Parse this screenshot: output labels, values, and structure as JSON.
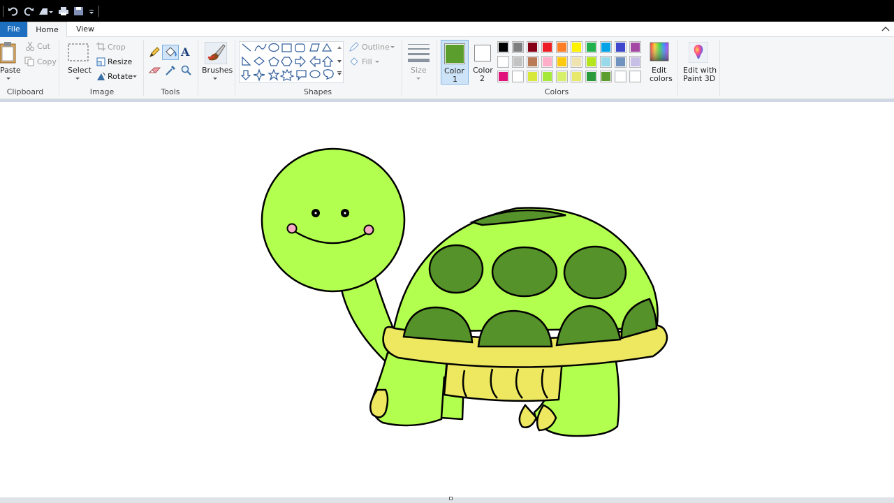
{
  "tabs": {
    "file": "File",
    "home": "Home",
    "view": "View"
  },
  "clipboard": {
    "paste": "Paste",
    "cut": "Cut",
    "copy": "Copy",
    "group": "Clipboard"
  },
  "image": {
    "select": "Select",
    "crop": "Crop",
    "resize": "Resize",
    "rotate": "Rotate",
    "group": "Image"
  },
  "tools": {
    "group": "Tools"
  },
  "brushes": {
    "label": "Brushes"
  },
  "shapes": {
    "outline": "Outline",
    "fill": "Fill",
    "group": "Shapes"
  },
  "size": {
    "label": "Size"
  },
  "colors": {
    "color1_line1": "Color",
    "color1_line2": "1",
    "color2_line1": "Color",
    "color2_line2": "2",
    "edit_line1": "Edit",
    "edit_line2": "colors",
    "paint3d_line1": "Edit with",
    "paint3d_line2": "Paint 3D",
    "group": "Colors",
    "color1_value": "#5b9e2d",
    "color2_value": "#ffffff",
    "palette": [
      "#000000",
      "#7f7f7f",
      "#880015",
      "#ed1c24",
      "#ff7f27",
      "#fff200",
      "#22b14c",
      "#00a2e8",
      "#3f48cc",
      "#a349a4",
      "#ffffff",
      "#c3c3c3",
      "#b97a57",
      "#ffaec9",
      "#ffc90e",
      "#efe4b0",
      "#b5e61d",
      "#99d9ea",
      "#7092be",
      "#c8bfe7",
      "#e0137a",
      "#ffffff",
      "#d8e83a",
      "#a6e83a",
      "#d7f06a",
      "#e8e86a",
      "#2b9a3a",
      "#5b9e2d",
      "#ffffff",
      "#ffffff"
    ]
  },
  "drawing": {
    "colors": {
      "skin": "#b3ff4f",
      "shell_spot": "#55922a",
      "belly": "#ede85f",
      "cheek": "#f5a9c2",
      "outline": "#000000"
    }
  }
}
